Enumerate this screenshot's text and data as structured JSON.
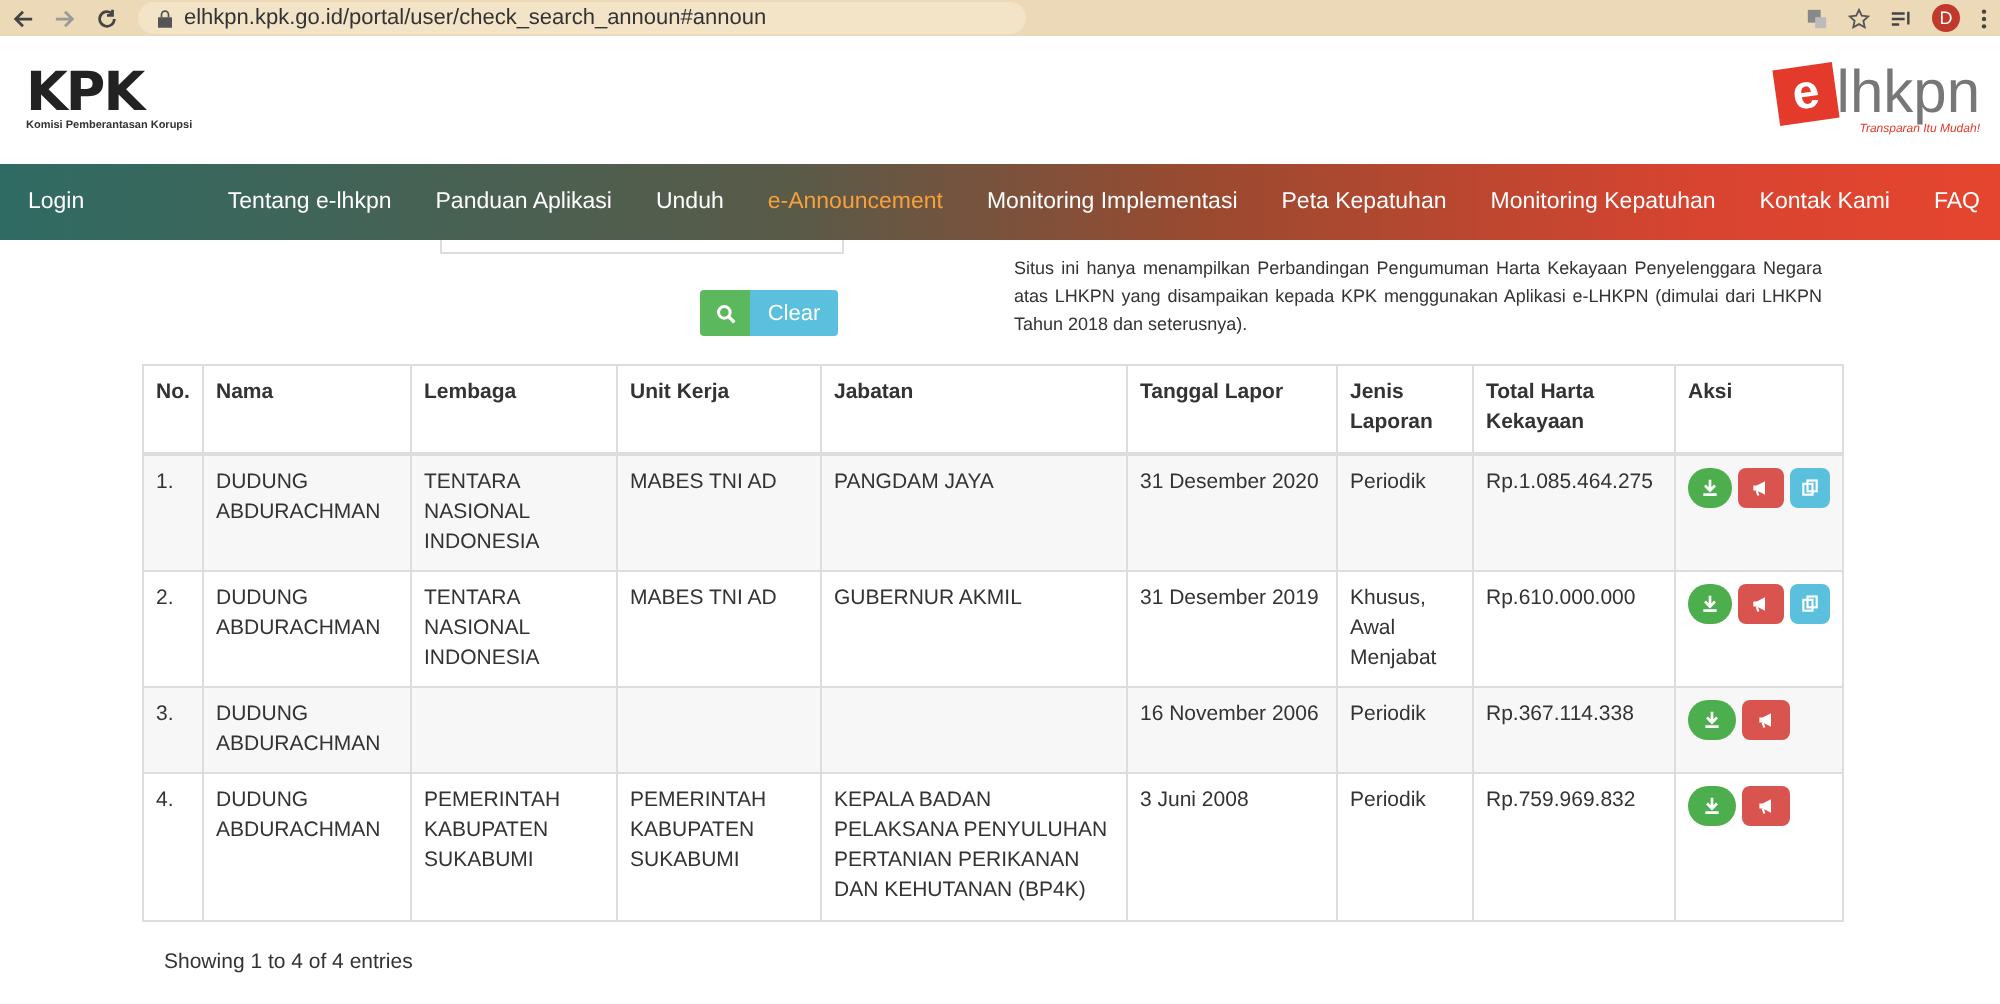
{
  "browser": {
    "url": "elhkpn.kpk.go.id/portal/user/check_search_announ#announ",
    "avatar": "D"
  },
  "header": {
    "logo_left": {
      "mark": "KPK",
      "subtitle": "Komisi Pemberantasan Korupsi"
    },
    "logo_right": {
      "badge": "e",
      "name": "lhkpn",
      "tagline": "Transparan Itu Mudah!"
    }
  },
  "nav": {
    "login": "Login",
    "items": [
      {
        "label": "Tentang e-lhkpn",
        "selected": false
      },
      {
        "label": "Panduan Aplikasi",
        "selected": false
      },
      {
        "label": "Unduh",
        "selected": false
      },
      {
        "label": "e-Announcement",
        "selected": true
      },
      {
        "label": "Monitoring Implementasi",
        "selected": false
      },
      {
        "label": "Peta Kepatuhan",
        "selected": false
      },
      {
        "label": "Monitoring Kepatuhan",
        "selected": false
      },
      {
        "label": "Kontak Kami",
        "selected": false
      },
      {
        "label": "FAQ",
        "selected": false
      }
    ]
  },
  "search": {
    "clear_button": "Clear"
  },
  "notice": "Situs ini hanya menampilkan Perbandingan Pengumuman Harta Kekayaan Penyelenggara Negara atas LHKPN yang disampaikan kepada KPK menggunakan Aplikasi e-LHKPN (dimulai dari LHKPN Tahun 2018 dan seterusnya).",
  "table": {
    "columns": [
      "No.",
      "Nama",
      "Lembaga",
      "Unit Kerja",
      "Jabatan",
      "Tanggal Lapor",
      "Jenis Laporan",
      "Total Harta Kekayaan",
      "Aksi"
    ],
    "rows": [
      {
        "cells": [
          "1.",
          "DUDUNG ABDURACHMAN",
          "TENTARA NASIONAL INDONESIA",
          "MABES TNI AD",
          "PANGDAM JAYA",
          "31 Desember 2020",
          "Periodik",
          "Rp.1.085.464.275"
        ],
        "actions": [
          {
            "kind": "download"
          },
          {
            "kind": "announce"
          },
          {
            "kind": "copy"
          }
        ]
      },
      {
        "cells": [
          "2.",
          "DUDUNG ABDURACHMAN",
          "TENTARA NASIONAL INDONESIA",
          "MABES TNI AD",
          "GUBERNUR AKMIL",
          "31 Desember 2019",
          "Khusus, Awal Menjabat",
          "Rp.610.000.000"
        ],
        "actions": [
          {
            "kind": "download"
          },
          {
            "kind": "announce"
          },
          {
            "kind": "copy"
          }
        ]
      },
      {
        "cells": [
          "3.",
          "DUDUNG ABDURACHMAN",
          "",
          "",
          "",
          "16 November 2006",
          "Periodik",
          "Rp.367.114.338"
        ],
        "actions": [
          {
            "kind": "download"
          },
          {
            "kind": "announce"
          }
        ]
      },
      {
        "cells": [
          "4.",
          "DUDUNG ABDURACHMAN",
          "PEMERINTAH KABUPATEN SUKABUMI",
          "PEMERINTAH KABUPATEN SUKABUMI",
          "KEPALA BADAN PELAKSANA PENYULUHAN PERTANIAN PERIKANAN DAN KEHUTANAN (BP4K)",
          "3 Juni 2008",
          "Periodik",
          "Rp.759.969.832"
        ],
        "actions": [
          {
            "kind": "download"
          },
          {
            "kind": "announce"
          }
        ]
      }
    ]
  },
  "footer": {
    "info": "Showing 1 to 4 of 4 entries"
  }
}
